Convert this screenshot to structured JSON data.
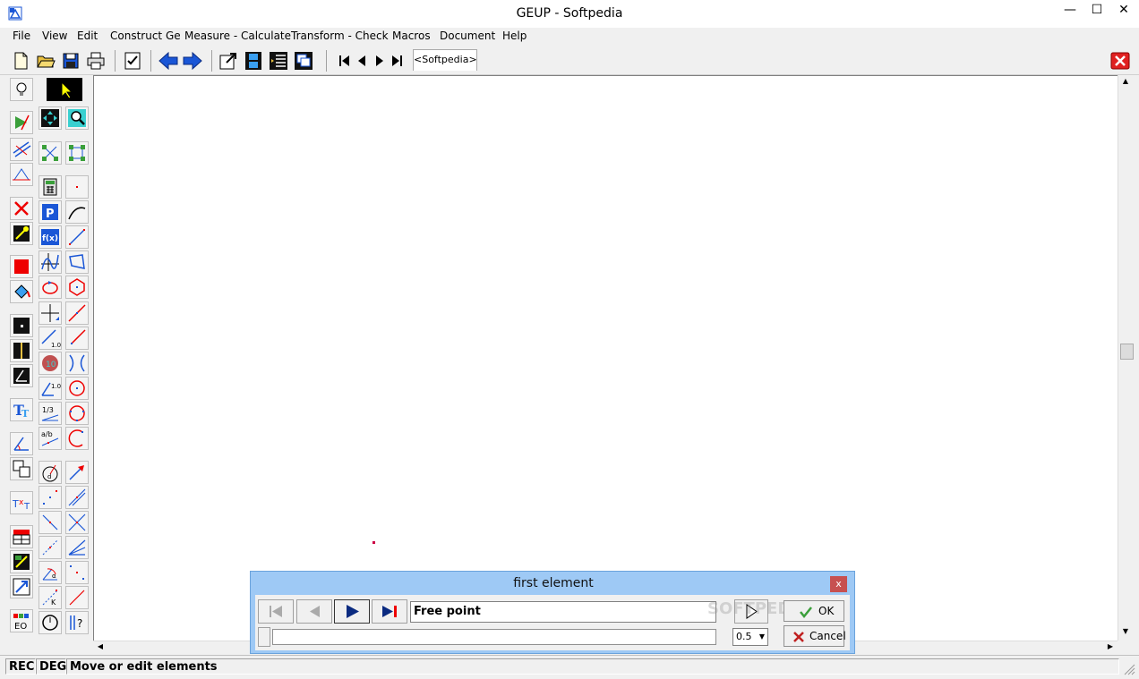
{
  "window": {
    "title": "GEUP - Softpedia",
    "minimize_glyph": "—",
    "maximize_glyph": "☐",
    "close_glyph": "✕"
  },
  "menu": [
    "File",
    "View",
    "Edit",
    "Construct Ge",
    "Measure - Calculate",
    "Transform - Check",
    "Macros",
    "Document",
    "Help"
  ],
  "toolbar": {
    "document_tab": "<Softpedia>",
    "icons": [
      "new-document-icon",
      "open-folder-icon",
      "save-icon",
      "print-icon",
      "checklist-icon",
      "arrow-left-icon",
      "arrow-right-icon",
      "export-icon",
      "film-icon",
      "list-icon",
      "windows-icon",
      "first-step-icon",
      "previous-step-icon",
      "next-step-icon",
      "last-step-icon",
      "close-document-icon"
    ]
  },
  "canvas": {
    "point_color": "#cc0044"
  },
  "dialog": {
    "title": "first element",
    "close_glyph": "x",
    "step_text": "Free point",
    "ok_label": "OK",
    "cancel_label": "Cancel",
    "speed_value": "0.5",
    "watermark": "SOFTPEDIA"
  },
  "status": {
    "rec": "REC",
    "deg": "DEG",
    "message": "Move or edit elements"
  },
  "colors": {
    "accent_blue": "#1a56d6",
    "red": "#e00000",
    "dialog_title_bg": "#9ec9f5"
  }
}
